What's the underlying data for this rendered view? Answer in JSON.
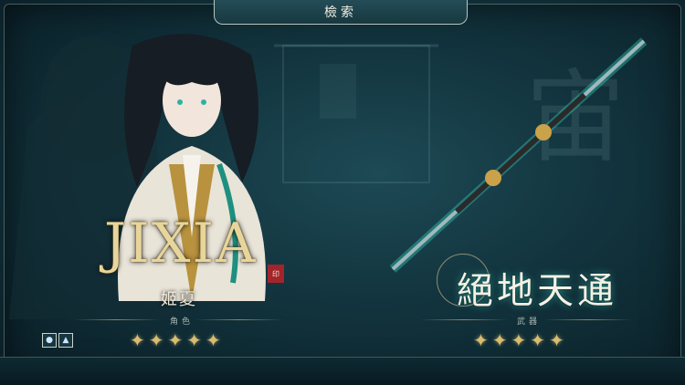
{
  "header": {
    "title": "檢索"
  },
  "character": {
    "logo_text": "JIXIA",
    "name": "姬夏",
    "role_label": "角色",
    "rarity": 5
  },
  "weapon": {
    "name": "絕地天通",
    "label": "武器",
    "rarity": 5
  },
  "elements": [
    {
      "icon": "water-drop-icon",
      "glyph": "💧"
    },
    {
      "icon": "mountain-icon",
      "glyph": "▲"
    }
  ],
  "colors": {
    "accent_gold": "#d9bd6e",
    "panel_teal": "#12333d",
    "jade_glow": "#3ad6c4"
  }
}
